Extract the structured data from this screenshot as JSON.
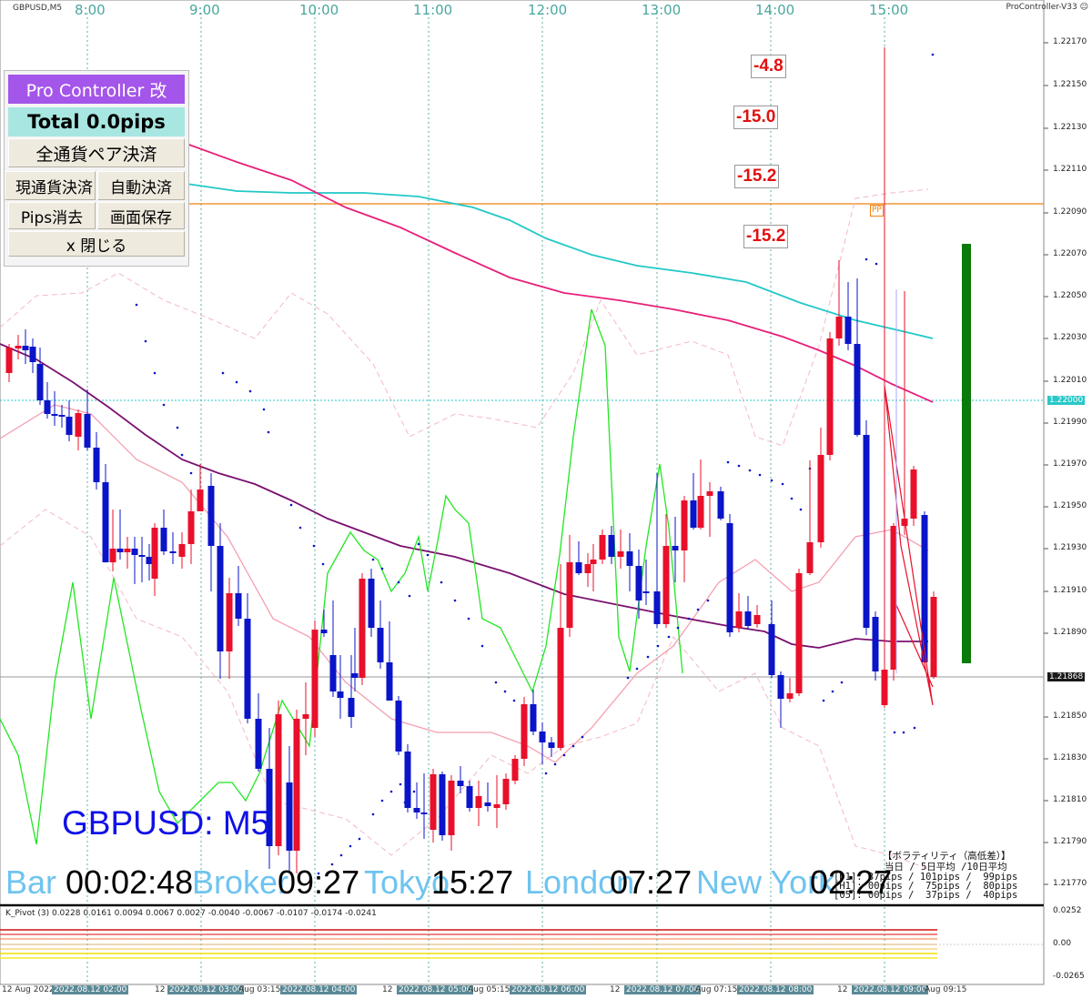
{
  "chart_header": {
    "symbol": "GBPUSD,M5",
    "ea_name": "ProController-V33 ☺"
  },
  "hour_labels": [
    "8:00",
    "9:00",
    "10:00",
    "11:00",
    "12:00",
    "13:00",
    "14:00",
    "15:00"
  ],
  "panel": {
    "title": "Pro Controller 改",
    "total": "Total   0.0pips",
    "close_all_pairs": "全通貨ペア決済",
    "close_current": "現通貨決済",
    "auto_close": "自動決済",
    "erase_pips": "Pips消去",
    "save_screen": "画面保存",
    "close_panel": "x 閉じる"
  },
  "pl_labels": [
    "-4.8",
    "-15.0",
    "-15.2",
    "-15.2"
  ],
  "pivot_label": "PP",
  "price_axis": {
    "ticks": [
      "1.22170",
      "1.22150",
      "1.22130",
      "1.22110",
      "1.22090",
      "1.22070",
      "1.22050",
      "1.22030",
      "1.22010",
      "1.21990",
      "1.21970",
      "1.21950",
      "1.21930",
      "1.21910",
      "1.21890",
      "1.21850",
      "1.21830",
      "1.21810",
      "1.21790",
      "1.21770"
    ],
    "ref_level_tag": "1.22000",
    "bid_tag": "1.21868",
    "accent_ref": "#28c8c8",
    "accent_bid": "#1a1a1a"
  },
  "overlay": {
    "symbol_timeframe": "GBPUSD: M5",
    "bar_label": "Bar",
    "bar_value": "00:02:48",
    "broker_label": "Broker",
    "broker_value": "09:27",
    "tokyo_label": "Tokyo",
    "tokyo_value": "15:27",
    "london_label": "London",
    "london_value": "07:27",
    "newyork_label": "New York",
    "newyork_value": "02:27"
  },
  "volatility": {
    "title": "【ボラティリティ（高低差）】",
    "header": "当日 / 5日平均 /10日平均",
    "row1": "[D1]: 37pips / 101pips /  99pips",
    "row2": "[H1]: 00pips /  75pips /  80pips",
    "row3": "[05]: 00pips /  37pips /  40pips"
  },
  "indicator": {
    "title": "K_Pivot (3) 0.0228 0.0161 0.0094 0.0067 0.0027 -0.0040 -0.0067 -0.0107 -0.0174 -0.0241",
    "ticks": [
      "0.0252",
      "0.00",
      "-0.0265"
    ]
  },
  "time_axis": {
    "labels": [
      "12 Aug 2022",
      "2022.08.12 02:00",
      "12",
      "2022.08.12 03:00",
      "Aug 03:15",
      "2022.08.12 04:00",
      "12",
      "2022.08.12 05:00",
      "Aug 05:15",
      "2022.08.12 06:00",
      "12",
      "2022.08.12 07:00",
      "Aug 07:15",
      "2022.08.12 08:00",
      "12",
      "2022.08.12 09:00",
      "Aug 09:15"
    ]
  },
  "colors": {
    "bull": "#e8102a",
    "bear": "#0a14c8",
    "ma_teal": "#22c8c8",
    "ma_pink": "#e8207a",
    "ma_purple": "#7a1070",
    "oscillator": "#22e622",
    "pivot_line": "#f08010",
    "sar": "#0a14c8"
  }
}
